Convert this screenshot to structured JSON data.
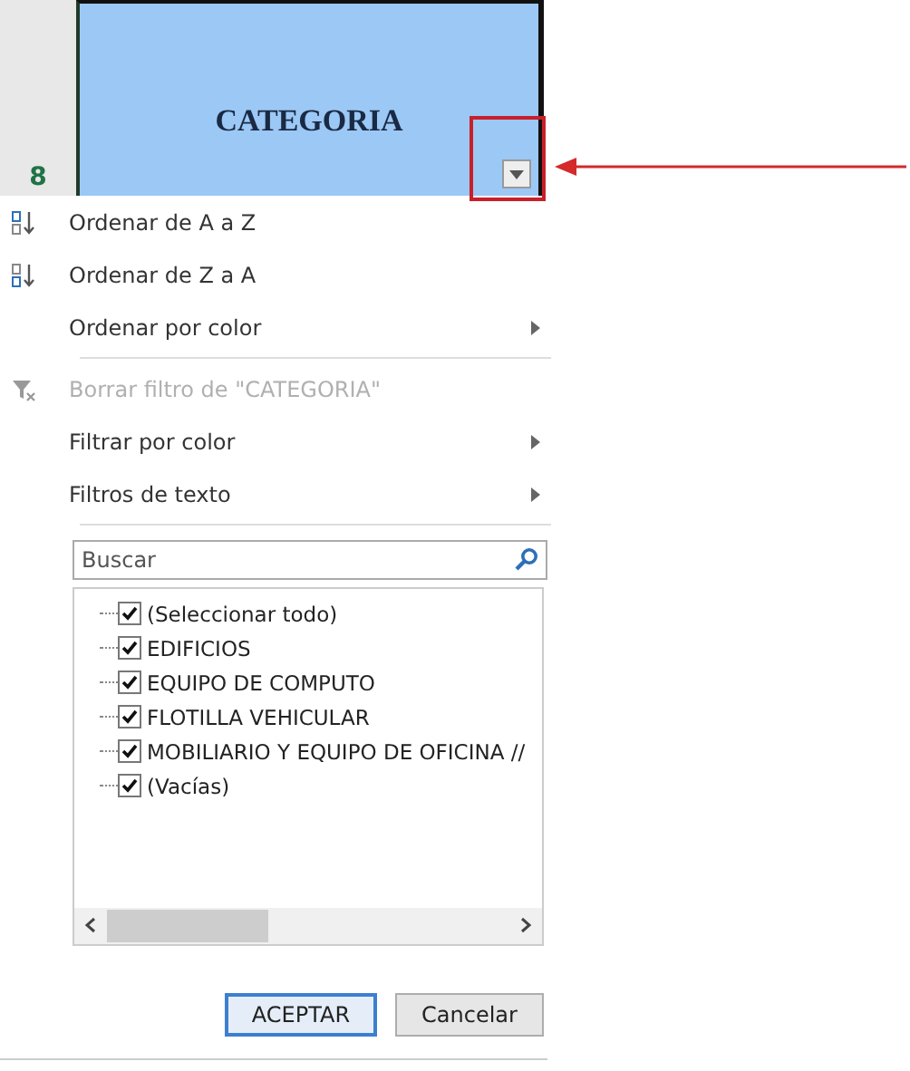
{
  "header": {
    "row_number": "8",
    "cell_text": "CATEGORIA",
    "filter_button": {
      "highlighted": true
    }
  },
  "menu": [
    {
      "kind": "sort",
      "label": "Ordenar de A a Z",
      "disabled": false,
      "submenu": false
    },
    {
      "kind": "sort",
      "label": "Ordenar de Z a A",
      "disabled": false,
      "submenu": false
    },
    {
      "kind": "item",
      "label": "Ordenar por color",
      "disabled": false,
      "submenu": true
    },
    {
      "kind": "separator"
    },
    {
      "kind": "clear",
      "label": "Borrar filtro de \"CATEGORIA\"",
      "disabled": true,
      "submenu": false
    },
    {
      "kind": "item",
      "label": "Filtrar por color",
      "disabled": false,
      "submenu": true
    },
    {
      "kind": "item",
      "label": "Filtros de texto",
      "disabled": false,
      "submenu": true
    },
    {
      "kind": "separator"
    }
  ],
  "search": {
    "placeholder": "Buscar"
  },
  "values": [
    {
      "label": "(Seleccionar todo)",
      "checked": true
    },
    {
      "label": "EDIFICIOS",
      "checked": true
    },
    {
      "label": "EQUIPO DE COMPUTO",
      "checked": true
    },
    {
      "label": "FLOTILLA VEHICULAR",
      "checked": true
    },
    {
      "label": "MOBILIARIO Y EQUIPO DE OFICINA //",
      "checked": true
    },
    {
      "label": "(Vacías)",
      "checked": true
    }
  ],
  "buttons": [
    {
      "label": "ACEPTAR",
      "default": true
    },
    {
      "label": "Cancelar",
      "default": false
    }
  ]
}
